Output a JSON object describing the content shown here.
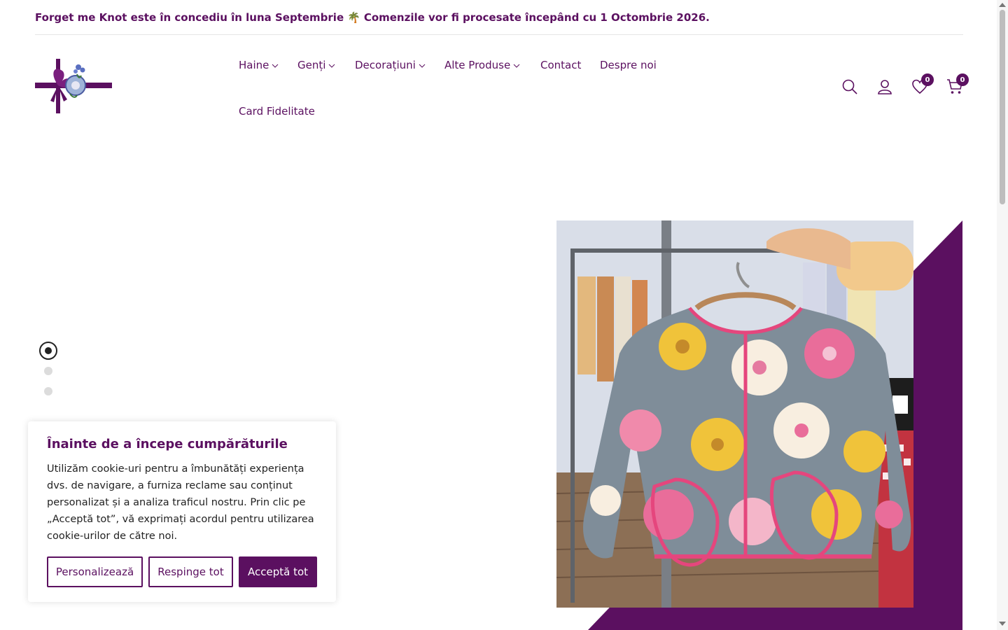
{
  "announcement": {
    "text_before": "Forget me Knot este în concediu în luna Septembrie",
    "emoji": "🌴",
    "text_after": "Comenzile vor fi procesate începând cu 1 Octombrie 2026."
  },
  "nav": {
    "items": [
      {
        "label": "Haine",
        "has_dropdown": true
      },
      {
        "label": "Genți",
        "has_dropdown": true
      },
      {
        "label": "Decorațiuni",
        "has_dropdown": true
      },
      {
        "label": "Alte Produse",
        "has_dropdown": true
      },
      {
        "label": "Contact",
        "has_dropdown": false
      },
      {
        "label": "Despre noi",
        "has_dropdown": false
      },
      {
        "label": "Card Fidelitate",
        "has_dropdown": false
      }
    ]
  },
  "header_icons": {
    "search": "search-icon",
    "account": "user-icon",
    "wishlist": "heart-icon",
    "cart": "cart-icon",
    "wishlist_count": "0",
    "cart_count": "0"
  },
  "slider": {
    "slides": 3,
    "active": 1
  },
  "cookie": {
    "title": "Înainte de a începe cumpărăturile",
    "body": "Utilizăm cookie-uri pentru a îmbunătăți experiența dvs. de navigare, a furniza reclame sau conținut personalizat și a analiza traficul nostru. Prin clic pe „Acceptă tot”, vă exprimați acordul pentru utilizarea cookie-urilor de către noi.",
    "customize_label": "Personalizează",
    "reject_label": "Respinge tot",
    "accept_label": "Acceptă tot"
  },
  "colors": {
    "brand": "#5b1060",
    "text": "#222222",
    "dot_inactive": "#dcdcdc"
  }
}
